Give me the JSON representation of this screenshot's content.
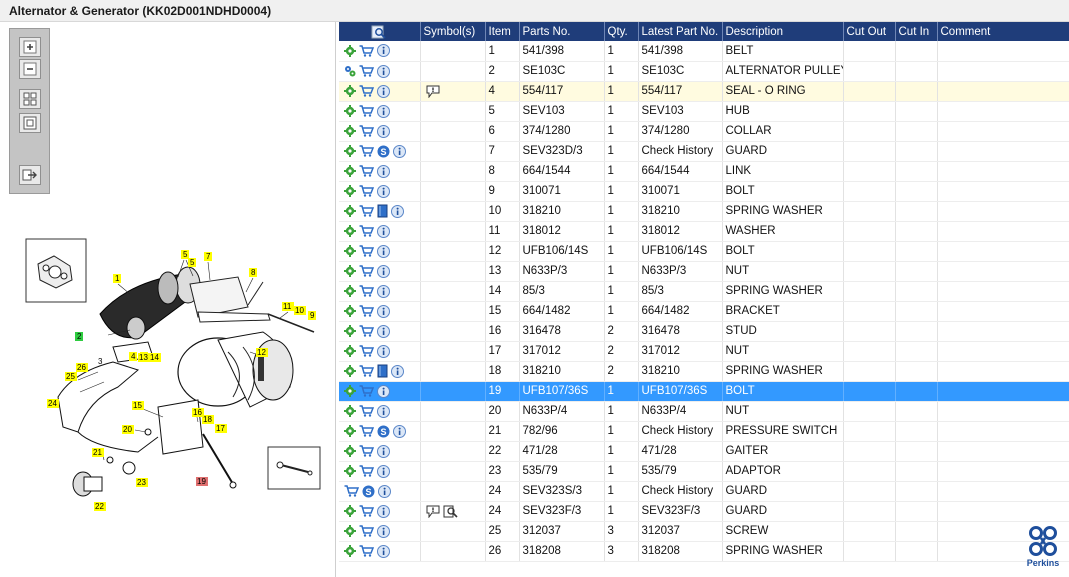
{
  "window": {
    "title": "Alternator & Generator (KK02D001NDHD0004)"
  },
  "toolbar": {
    "buttons": [
      {
        "name": "zoom-in-button",
        "icon": "zoom-in-icon"
      },
      {
        "name": "zoom-out-button",
        "icon": "zoom-out-icon"
      },
      {
        "name": "fit-view-button",
        "icon": "fit-view-icon"
      },
      {
        "name": "actual-size-button",
        "icon": "actual-size-icon"
      },
      {
        "name": "export-button",
        "icon": "export-icon"
      }
    ]
  },
  "diagram": {
    "labels": [
      "1",
      "2",
      "3",
      "4",
      "5",
      "5",
      "6",
      "7",
      "8",
      "9",
      "10",
      "11",
      "12",
      "13",
      "14",
      "15",
      "16",
      "17",
      "18",
      "19",
      "20",
      "21",
      "22",
      "23",
      "24",
      "25",
      "26"
    ],
    "highlight_colors": {
      "normal": "#ffff00",
      "active": "#2ecc40",
      "selected": "#e07070"
    }
  },
  "grid": {
    "columns": {
      "search": "",
      "symbols": "Symbol(s)",
      "item": "Item",
      "parts_no": "Parts No.",
      "qty": "Qty.",
      "latest_part_no": "Latest Part No.",
      "description": "Description",
      "cut_out": "Cut Out",
      "cut_in": "Cut In",
      "comment": "Comment"
    },
    "rows": [
      {
        "icons": [
          "gear-icon",
          "cart-icon",
          "info-icon"
        ],
        "symbols": [],
        "item": "1",
        "parts_no": "541/398",
        "qty": "1",
        "latest": "541/398",
        "description": "BELT"
      },
      {
        "icons": [
          "gears-icon",
          "cart-icon",
          "info-icon"
        ],
        "symbols": [],
        "item": "2",
        "parts_no": "SE103C",
        "qty": "1",
        "latest": "SE103C",
        "description": "ALTERNATOR PULLEY"
      },
      {
        "icons": [
          "gear-icon",
          "cart-icon",
          "info-icon"
        ],
        "symbols": [
          "comment-icon"
        ],
        "item": "4",
        "parts_no": "554/117",
        "qty": "1",
        "latest": "554/117",
        "description": "SEAL - O RING",
        "state": "highlight"
      },
      {
        "icons": [
          "gear-icon",
          "cart-icon",
          "info-icon"
        ],
        "symbols": [],
        "item": "5",
        "parts_no": "SEV103",
        "qty": "1",
        "latest": "SEV103",
        "description": "HUB"
      },
      {
        "icons": [
          "gear-icon",
          "cart-icon",
          "info-icon"
        ],
        "symbols": [],
        "item": "6",
        "parts_no": "374/1280",
        "qty": "1",
        "latest": "374/1280",
        "description": "COLLAR"
      },
      {
        "icons": [
          "gear-icon",
          "cart-icon",
          "s-badge-icon",
          "info-icon"
        ],
        "symbols": [],
        "item": "7",
        "parts_no": "SEV323D/3",
        "qty": "1",
        "latest": "Check History",
        "description": "GUARD"
      },
      {
        "icons": [
          "gear-icon",
          "cart-icon",
          "info-icon"
        ],
        "symbols": [],
        "item": "8",
        "parts_no": "664/1544",
        "qty": "1",
        "latest": "664/1544",
        "description": "LINK"
      },
      {
        "icons": [
          "gear-icon",
          "cart-icon",
          "info-icon"
        ],
        "symbols": [],
        "item": "9",
        "parts_no": "310071",
        "qty": "1",
        "latest": "310071",
        "description": "BOLT"
      },
      {
        "icons": [
          "gear-icon",
          "cart-icon",
          "book-icon",
          "info-icon"
        ],
        "symbols": [],
        "item": "10",
        "parts_no": "318210",
        "qty": "1",
        "latest": "318210",
        "description": "SPRING WASHER"
      },
      {
        "icons": [
          "gear-icon",
          "cart-icon",
          "info-icon"
        ],
        "symbols": [],
        "item": "11",
        "parts_no": "318012",
        "qty": "1",
        "latest": "318012",
        "description": "WASHER"
      },
      {
        "icons": [
          "gear-icon",
          "cart-icon",
          "info-icon"
        ],
        "symbols": [],
        "item": "12",
        "parts_no": "UFB106/14S",
        "qty": "1",
        "latest": "UFB106/14S",
        "description": "BOLT"
      },
      {
        "icons": [
          "gear-icon",
          "cart-icon",
          "info-icon"
        ],
        "symbols": [],
        "item": "13",
        "parts_no": "N633P/3",
        "qty": "1",
        "latest": "N633P/3",
        "description": "NUT"
      },
      {
        "icons": [
          "gear-icon",
          "cart-icon",
          "info-icon"
        ],
        "symbols": [],
        "item": "14",
        "parts_no": "85/3",
        "qty": "1",
        "latest": "85/3",
        "description": "SPRING WASHER"
      },
      {
        "icons": [
          "gear-icon",
          "cart-icon",
          "info-icon"
        ],
        "symbols": [],
        "item": "15",
        "parts_no": "664/1482",
        "qty": "1",
        "latest": "664/1482",
        "description": "BRACKET"
      },
      {
        "icons": [
          "gear-icon",
          "cart-icon",
          "info-icon"
        ],
        "symbols": [],
        "item": "16",
        "parts_no": "316478",
        "qty": "2",
        "latest": "316478",
        "description": "STUD"
      },
      {
        "icons": [
          "gear-icon",
          "cart-icon",
          "info-icon"
        ],
        "symbols": [],
        "item": "17",
        "parts_no": "317012",
        "qty": "2",
        "latest": "317012",
        "description": "NUT"
      },
      {
        "icons": [
          "gear-icon",
          "cart-icon",
          "book-icon",
          "info-icon"
        ],
        "symbols": [],
        "item": "18",
        "parts_no": "318210",
        "qty": "2",
        "latest": "318210",
        "description": "SPRING WASHER"
      },
      {
        "icons": [
          "gear-icon",
          "cart-icon",
          "info-icon"
        ],
        "symbols": [],
        "item": "19",
        "parts_no": "UFB107/36S",
        "qty": "1",
        "latest": "UFB107/36S",
        "description": "BOLT",
        "state": "selected"
      },
      {
        "icons": [
          "gear-icon",
          "cart-icon",
          "info-icon"
        ],
        "symbols": [],
        "item": "20",
        "parts_no": "N633P/4",
        "qty": "1",
        "latest": "N633P/4",
        "description": "NUT"
      },
      {
        "icons": [
          "gear-icon",
          "cart-icon",
          "s-badge-icon",
          "info-icon"
        ],
        "symbols": [],
        "item": "21",
        "parts_no": "782/96",
        "qty": "1",
        "latest": "Check History",
        "description": "PRESSURE SWITCH"
      },
      {
        "icons": [
          "gear-icon",
          "cart-icon",
          "info-icon"
        ],
        "symbols": [],
        "item": "22",
        "parts_no": "471/28",
        "qty": "1",
        "latest": "471/28",
        "description": "GAITER"
      },
      {
        "icons": [
          "gear-icon",
          "cart-icon",
          "info-icon"
        ],
        "symbols": [],
        "item": "23",
        "parts_no": "535/79",
        "qty": "1",
        "latest": "535/79",
        "description": "ADAPTOR"
      },
      {
        "icons": [
          "cart-icon",
          "s-badge-icon",
          "info-icon"
        ],
        "symbols": [],
        "item": "24",
        "parts_no": "SEV323S/3",
        "qty": "1",
        "latest": "Check History",
        "description": "GUARD"
      },
      {
        "icons": [
          "gear-icon",
          "cart-icon",
          "info-icon"
        ],
        "symbols": [
          "comment-icon",
          "search-doc-icon"
        ],
        "item": "24",
        "parts_no": "SEV323F/3",
        "qty": "1",
        "latest": "SEV323F/3",
        "description": "GUARD"
      },
      {
        "icons": [
          "gear-icon",
          "cart-icon",
          "info-icon"
        ],
        "symbols": [],
        "item": "25",
        "parts_no": "312037",
        "qty": "3",
        "latest": "312037",
        "description": "SCREW"
      },
      {
        "icons": [
          "gear-icon",
          "cart-icon",
          "info-icon"
        ],
        "symbols": [],
        "item": "26",
        "parts_no": "318208",
        "qty": "3",
        "latest": "318208",
        "description": "SPRING WASHER"
      }
    ]
  },
  "brand": {
    "name": "Perkins",
    "color": "#1f4f9c",
    "header_color": "#1f3d7a",
    "selected_color": "#3399ff"
  }
}
